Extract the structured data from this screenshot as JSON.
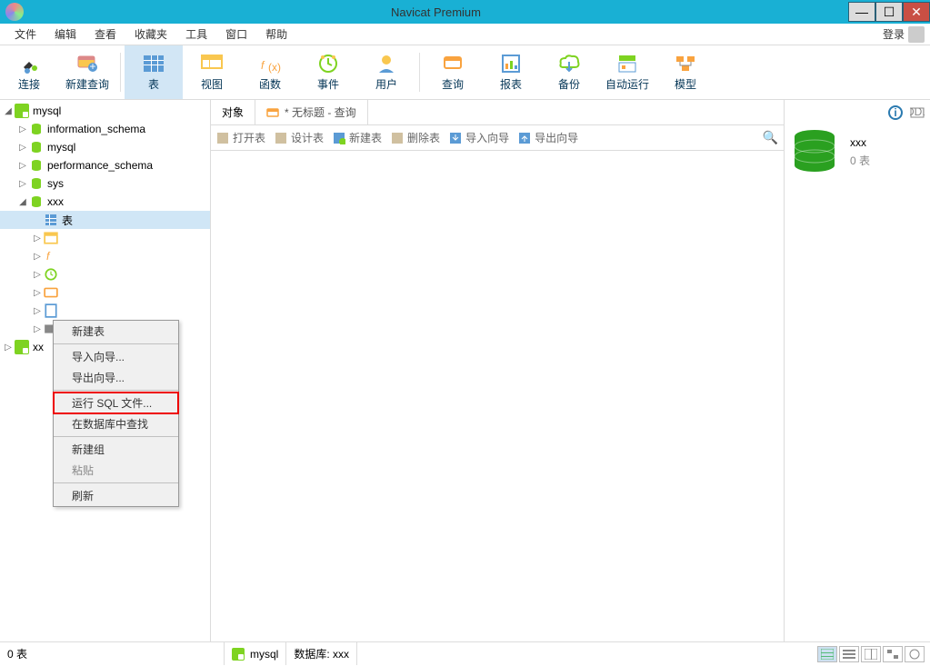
{
  "window": {
    "title": "Navicat Premium"
  },
  "menu": {
    "items": [
      "文件",
      "编辑",
      "查看",
      "收藏夹",
      "工具",
      "窗口",
      "帮助"
    ],
    "login": "登录"
  },
  "toolbar": {
    "connect": "连接",
    "newquery": "新建查询",
    "table": "表",
    "view": "视图",
    "function": "函数",
    "event": "事件",
    "user": "用户",
    "query": "查询",
    "report": "报表",
    "backup": "备份",
    "autorun": "自动运行",
    "model": "模型"
  },
  "tree": {
    "mysql": "mysql",
    "dbs": [
      "information_schema",
      "mysql",
      "performance_schema",
      "sys",
      "xxx"
    ],
    "xxx_children": [
      "表"
    ],
    "xx": "xx"
  },
  "context_menu": {
    "new_table": "新建表",
    "import_wizard": "导入向导...",
    "export_wizard": "导出向导...",
    "run_sql": "运行 SQL 文件...",
    "find_in_db": "在数据库中查找",
    "new_group": "新建组",
    "paste": "粘贴",
    "refresh": "刷新"
  },
  "tabs": {
    "objects": "对象",
    "untitled": "* 无标题 - 查询"
  },
  "subtoolbar": {
    "open": "打开表",
    "design": "设计表",
    "new": "新建表",
    "delete": "删除表",
    "import": "导入向导",
    "export": "导出向导"
  },
  "right": {
    "name": "xxx",
    "count": "0 表"
  },
  "status": {
    "left": "0 表",
    "conn": "mysql",
    "db_label": "数据库:",
    "db": "xxx"
  }
}
